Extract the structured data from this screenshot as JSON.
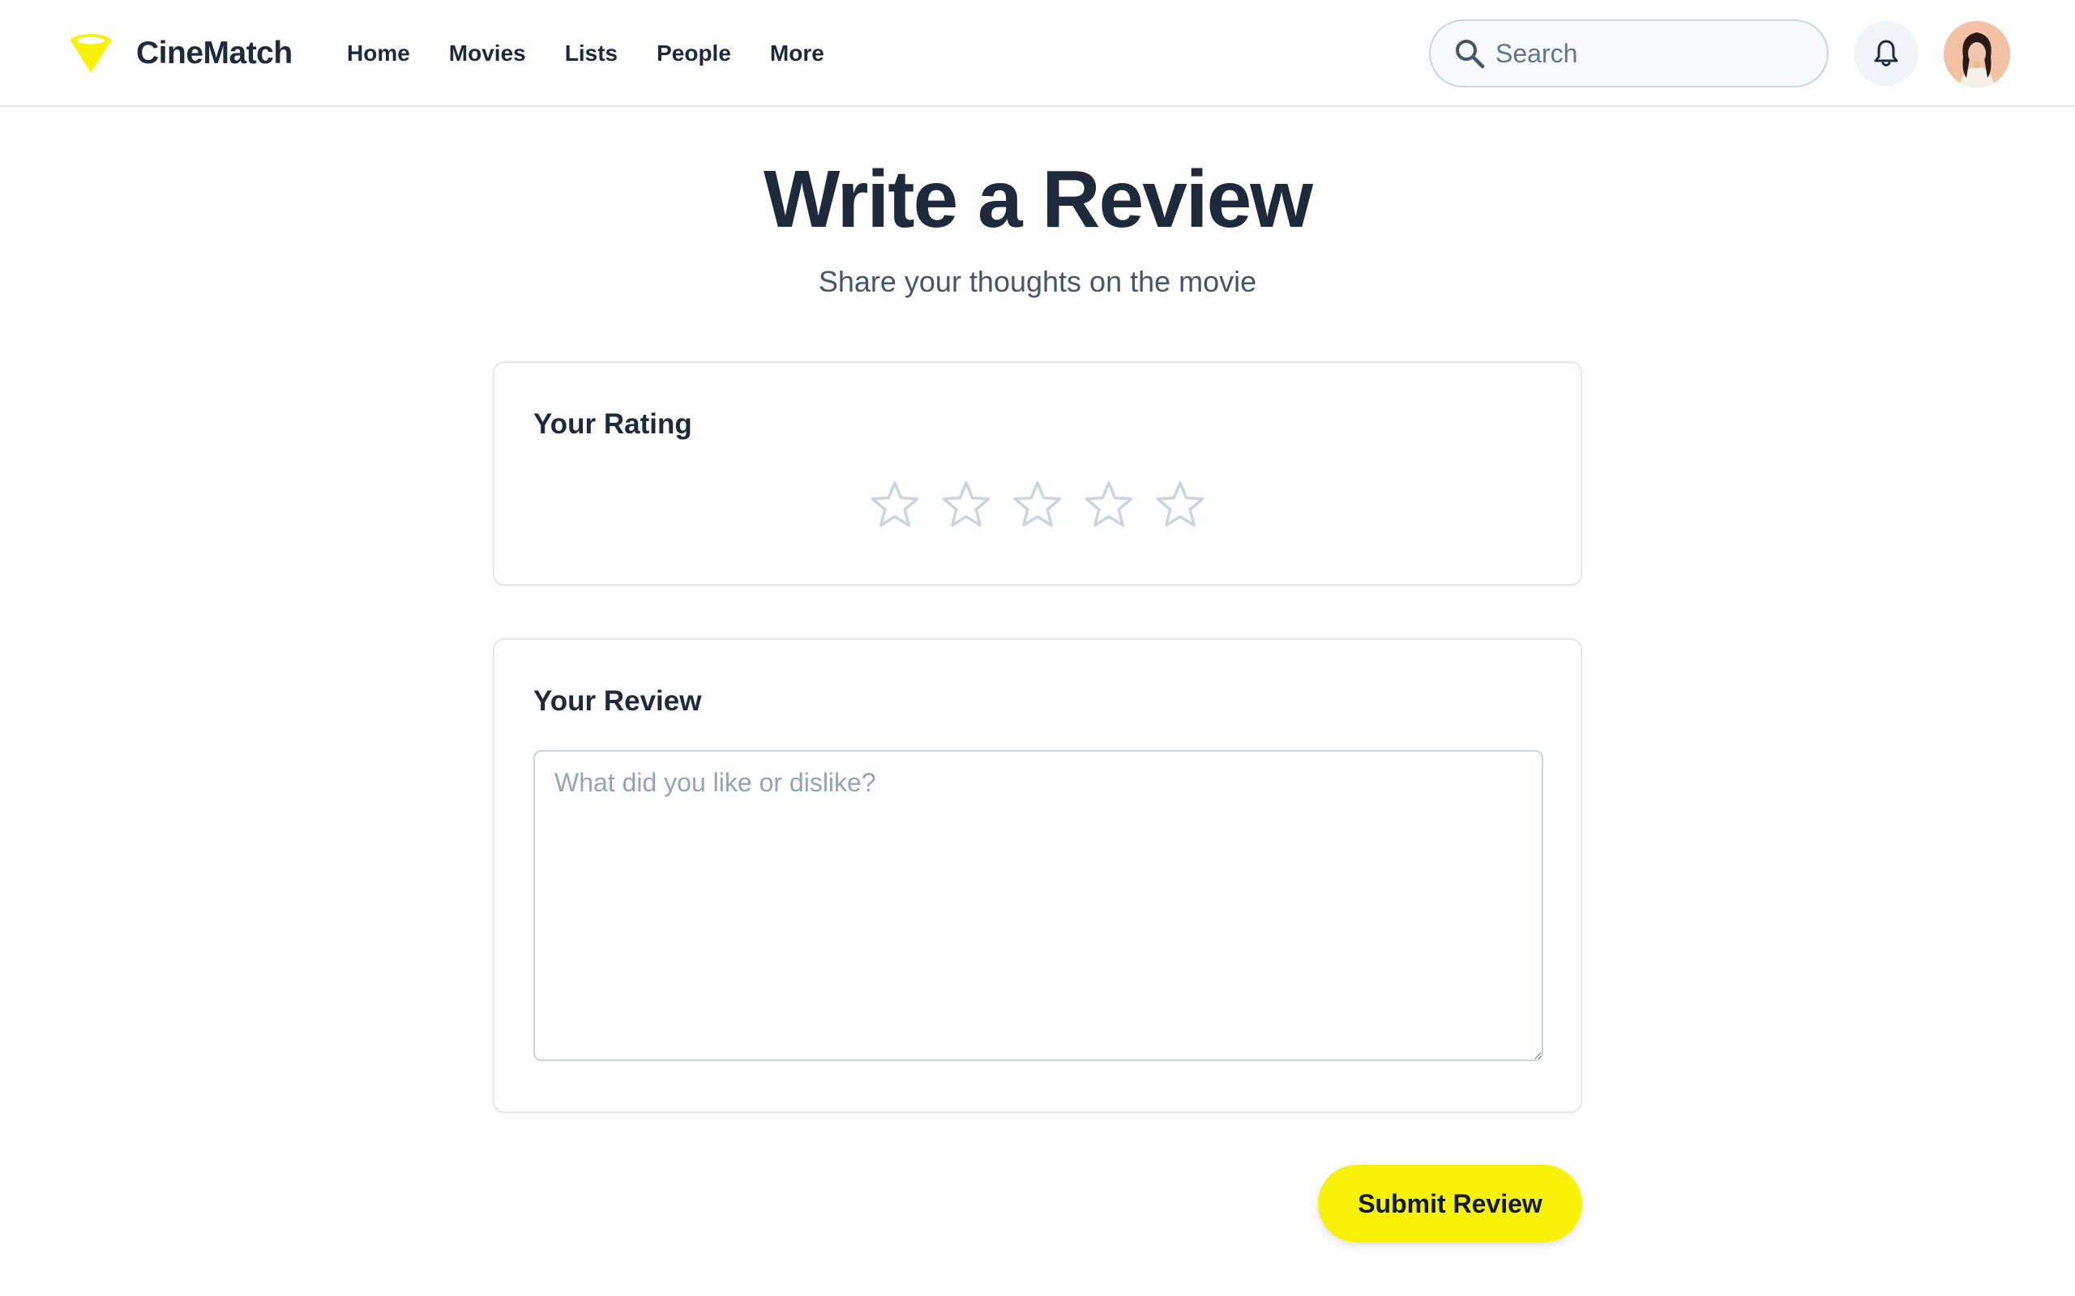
{
  "app": {
    "brand": "CineMatch",
    "accent_color": "#f7f207"
  },
  "nav": {
    "items": [
      {
        "label": "Home"
      },
      {
        "label": "Movies"
      },
      {
        "label": "Lists"
      },
      {
        "label": "People"
      },
      {
        "label": "More"
      }
    ]
  },
  "search": {
    "placeholder": "Search",
    "value": "",
    "icon": "search-icon"
  },
  "header_icons": {
    "notifications": "bell-icon",
    "profile": "avatar"
  },
  "page": {
    "title": "Write a Review",
    "subtitle": "Share your thoughts on the movie"
  },
  "rating": {
    "title": "Your Rating",
    "max": 5,
    "value": 0,
    "star_empty_color": "#cbd5e1"
  },
  "review": {
    "title": "Your Review",
    "placeholder": "What did you like or dislike?",
    "value": ""
  },
  "actions": {
    "submit_label": "Submit Review"
  }
}
